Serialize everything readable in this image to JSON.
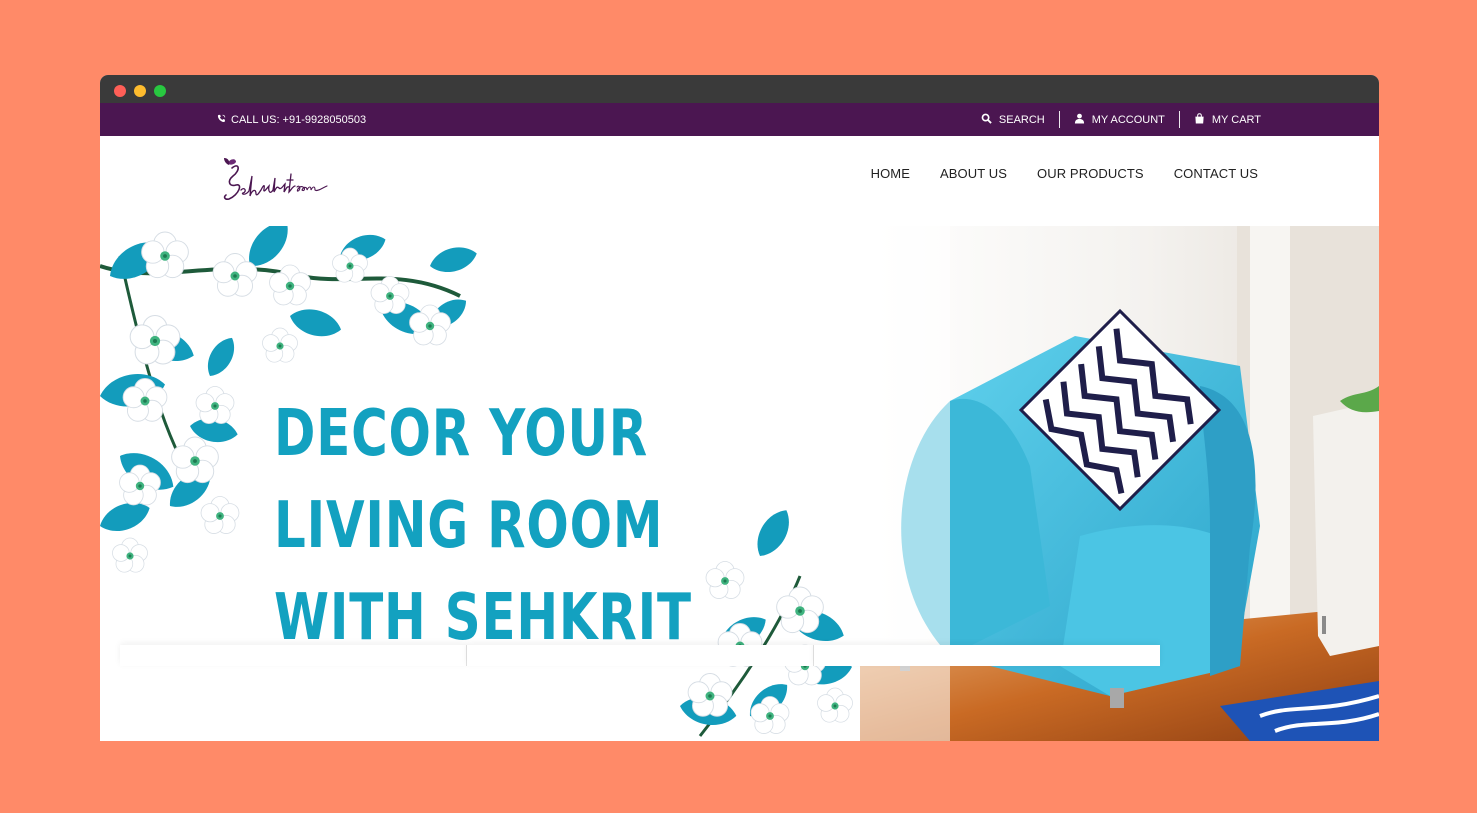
{
  "topbar": {
    "call_label": "CALL US: +91-9928050503",
    "search_label": "SEARCH",
    "account_label": "MY ACCOUNT",
    "cart_label": "MY CART"
  },
  "brand": {
    "logo_text": "Sehkrit.com",
    "color": "#4B1651"
  },
  "nav": {
    "items": [
      "HOME",
      "ABOUT US",
      "OUR PRODUCTS",
      "CONTACT US"
    ]
  },
  "hero": {
    "headline_line1": "DECOR YOUR",
    "headline_line2": "LIVING ROOM",
    "headline_line3": "WITH SEHKRIT",
    "accent": "#13A1C0"
  },
  "colors": {
    "background": "#FF8A68",
    "topbar": "#4B1651",
    "chair": "#3CB8D8"
  }
}
